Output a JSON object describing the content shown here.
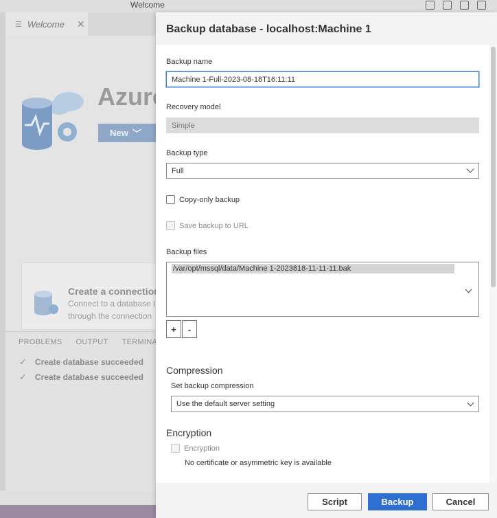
{
  "window": {
    "title": "Welcome"
  },
  "editor": {
    "tab_label": "Welcome",
    "brand_text": "Azure",
    "new_button": "New",
    "connection_card": {
      "title": "Create a connection",
      "desc_line1": "Connect to a database i",
      "desc_line2": "through the connection"
    },
    "panel_tabs": [
      "PROBLEMS",
      "OUTPUT",
      "TERMINA"
    ],
    "messages": [
      "Create database succeeded",
      "Create database succeeded"
    ]
  },
  "dialog": {
    "title": "Backup database - localhost:Machine 1",
    "backup_name_label": "Backup name",
    "backup_name_value": "Machine 1-Full-2023-08-18T16:11:11",
    "recovery_model_label": "Recovery model",
    "recovery_model_value": "Simple",
    "backup_type_label": "Backup type",
    "backup_type_value": "Full",
    "copy_only_label": "Copy-only backup",
    "save_to_url_label": "Save backup to URL",
    "backup_files_label": "Backup files",
    "backup_file_path": "/var/opt/mssql/data/Machine 1-2023818-11-11-11.bak",
    "add_file": "+",
    "remove_file": "-",
    "compression_heading": "Compression",
    "set_compression_label": "Set backup compression",
    "compression_value": "Use the default server setting",
    "encryption_heading": "Encryption",
    "encryption_label": "Encryption",
    "encryption_note": "No certificate or asymmetric key is available",
    "footer": {
      "script": "Script",
      "backup": "Backup",
      "cancel": "Cancel"
    }
  },
  "colors": {
    "primary_button": "#2f6fd0",
    "focus_border": "#3b7ad6",
    "statusbar": "#9c8aa3"
  }
}
